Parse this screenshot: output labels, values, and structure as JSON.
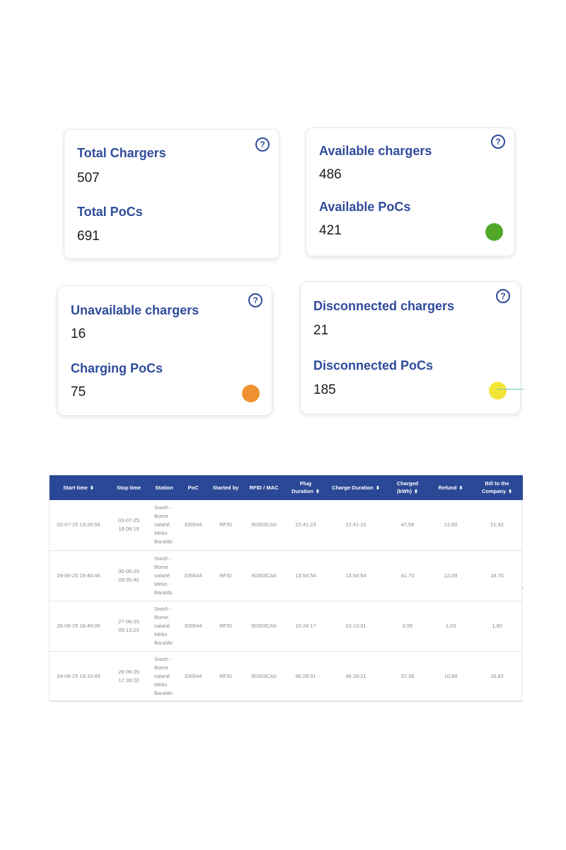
{
  "cards": [
    {
      "label1": "Total Chargers",
      "value1": "507",
      "label2": "Total PoCs",
      "value2": "691",
      "status": ""
    },
    {
      "label1": "Available chargers",
      "value1": "486",
      "label2": "Available PoCs",
      "value2": "421",
      "status": "#52a829"
    },
    {
      "label1": "Unavailable chargers",
      "value1": "16",
      "label2": "Charging PoCs",
      "value2": "75",
      "status": "#ee9232"
    },
    {
      "label1": "Disconnected chargers",
      "value1": "21",
      "label2": "Disconnected PoCs",
      "value2": "185",
      "status": "#f2e53a"
    }
  ],
  "help_icon": "?",
  "table": {
    "headers": [
      "Start time",
      "Stop time",
      "Station",
      "PoC",
      "Started by",
      "RFID / MAC",
      "Plug Duration",
      "Charge Duration",
      "Charged (kWh)",
      "Refund",
      "Bill to the Company"
    ],
    "sortable": [
      true,
      false,
      false,
      false,
      false,
      false,
      true,
      true,
      true,
      true,
      true
    ],
    "rows": [
      [
        "02-07-25 19:26:56",
        "03-07-25 18:08:19",
        "Swish - Borne salarié Mirko Baraldo",
        "336544",
        "RFID",
        "90303CA0",
        "22:41:23",
        "22:41:10",
        "47,59",
        "13,80",
        "21,42"
      ],
      [
        "29-06-25 19:40:46",
        "30-06-25 09:35:40",
        "Swish - Borne salarié Mirko Baraldo",
        "336544",
        "RFID",
        "90303CA0",
        "13:54:54",
        "13:54:54",
        "41,70",
        "12,09",
        "18,76"
      ],
      [
        "26-06-25 18:49:06",
        "27-06-25 05:13:23",
        "Swish - Borne salarié Mirko Baraldo",
        "336544",
        "RFID",
        "90303CA0",
        "10:24:17",
        "10:13:31",
        "3,55",
        "1,03",
        "1,60"
      ],
      [
        "24-06-25 19:10:49",
        "26-06-25 17:39:20",
        "Swish - Borne salarié Mirko Baraldo",
        "336544",
        "RFID",
        "90303CA0",
        "46:28:31",
        "46:28:21",
        "37,38",
        "10,84",
        "16,82"
      ]
    ]
  },
  "colors": {
    "label": "#2f4b9b",
    "header_bg": "#2a4896",
    "accent_line": "#6cc7bd"
  }
}
